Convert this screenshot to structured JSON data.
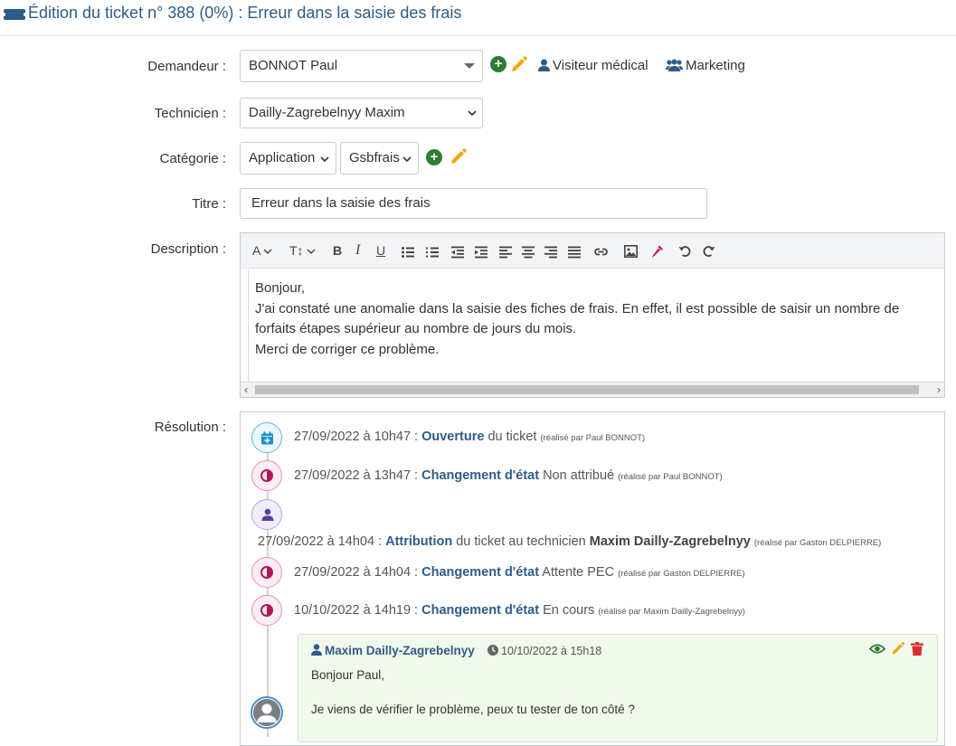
{
  "header": {
    "title": "Édition du ticket n° 388 (0%) : Erreur dans la saisie des frais"
  },
  "form": {
    "requester": {
      "label": "Demandeur :",
      "value": "BONNOT Paul",
      "profile": "Visiteur médical",
      "group": "Marketing"
    },
    "technician": {
      "label": "Technicien :",
      "value": "Dailly-Zagrebelnyy Maxim"
    },
    "category": {
      "label": "Catégorie :",
      "value1": "Application",
      "value2": "Gsbfrais"
    },
    "title": {
      "label": "Titre :",
      "value": "Erreur dans la saisie des frais"
    },
    "description": {
      "label": "Description :",
      "lines": [
        "Bonjour,",
        "J'ai constaté une anomalie dans la saisie des fiches de frais. En effet, il est possible de saisir un nombre de",
        "forfaits étapes supérieur au nombre de jours du mois.",
        "Merci de corriger ce problème."
      ]
    }
  },
  "resolution": {
    "label": "Résolution :",
    "events": [
      {
        "date": "27/09/2022 à 10h47 : ",
        "action": "Ouverture",
        "rest": " du ticket ",
        "by": "(réalisé par Paul BONNOT)"
      },
      {
        "date": "27/09/2022 à 13h47 : ",
        "action": "Changement d'état",
        "rest": " Non attribué ",
        "by": "(réalisé par Paul BONNOT)"
      },
      {
        "date": "27/09/2022 à 14h04 : ",
        "action": "Attribution",
        "rest": " du ticket au technicien ",
        "tech": "Maxim Dailly-Zagrebelnyy",
        "by": "(réalisé par Gaston DELPIERRE)"
      },
      {
        "date": "27/09/2022 à 14h04 : ",
        "action": "Changement d'état",
        "rest": " Attente PEC ",
        "by": "(réalisé par Gaston DELPIERRE)"
      },
      {
        "date": "10/10/2022 à 14h19 : ",
        "action": "Changement d'état",
        "rest": " En cours ",
        "by": "(réalisé par Maxim Dailly-Zagrebelnyy)"
      }
    ],
    "followup": {
      "author": "Maxim Dailly-Zagrebelnyy",
      "date": "10/10/2022 à 15h18",
      "line1": "Bonjour Paul,",
      "line2": "Je viens de vérifier le problème, peux tu tester de ton côté ?"
    }
  },
  "colors": {
    "accent": "#2d5c88",
    "add": "#2e7d32",
    "edit": "#f0a800",
    "delete": "#d32f2f",
    "status": "#b0185a",
    "open": "#1b8fc9"
  }
}
